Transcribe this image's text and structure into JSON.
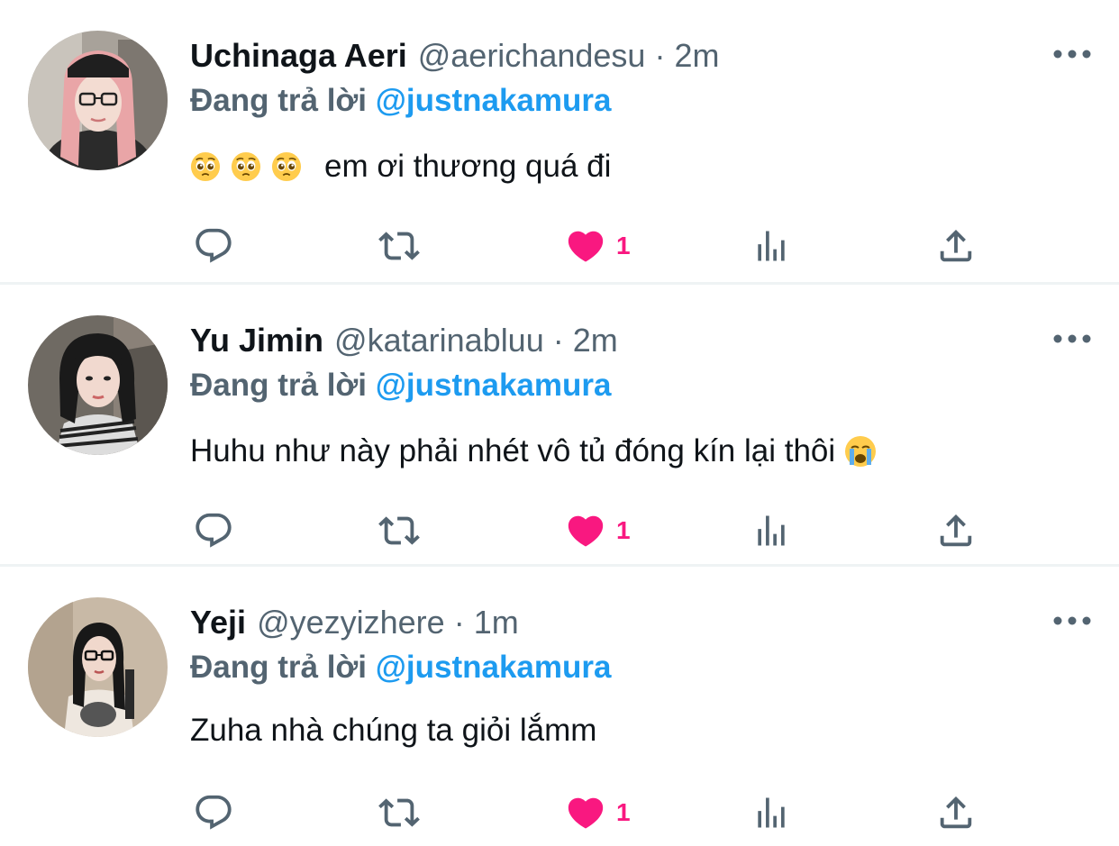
{
  "colors": {
    "text": "#0f1419",
    "secondary": "#536471",
    "link": "#1d9bf0",
    "like": "#f91880",
    "divider": "#eff3f4"
  },
  "tweets": [
    {
      "name": "Uchinaga Aeri",
      "handle": "@aerichandesu",
      "separator": "·",
      "time": "2m",
      "reply_label": "Đang trả lời",
      "reply_user": "@justnakamura",
      "text": "em ơi thương quá đi",
      "emojis_before": [
        "pleading-face",
        "pleading-face",
        "pleading-face"
      ],
      "like_count": "1",
      "liked": true
    },
    {
      "name": "Yu Jimin",
      "handle": "@katarinabluu",
      "separator": "·",
      "time": "2m",
      "reply_label": "Đang trả lời",
      "reply_user": "@justnakamura",
      "text": "Huhu như này phải nhét vô tủ đóng kín lại thôi",
      "emoji_after": "loudly-crying-face",
      "like_count": "1",
      "liked": true
    },
    {
      "name": "Yeji",
      "handle": "@yezyizhere",
      "separator": "·",
      "time": "1m",
      "reply_label": "Đang trả lời",
      "reply_user": "@justnakamura",
      "text": "Zuha nhà chúng ta giỏi lắmm",
      "like_count": "1",
      "liked": true
    }
  ]
}
